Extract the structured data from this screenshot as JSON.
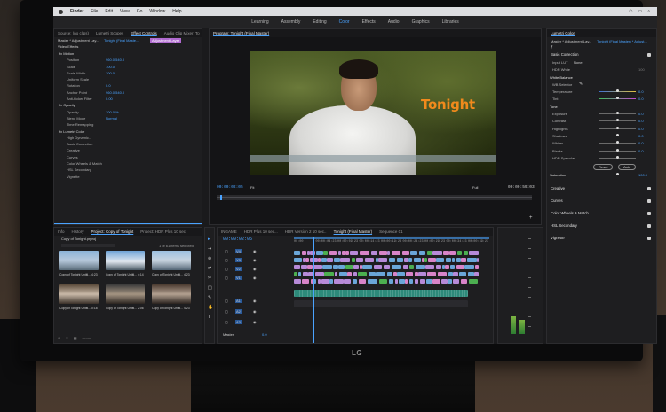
{
  "menubar": {
    "app_name": "Finder",
    "items": [
      "File",
      "Edit",
      "View",
      "Go",
      "Window",
      "Help"
    ]
  },
  "workspaces": {
    "tabs": [
      "Learning",
      "Assembly",
      "Editing",
      "Color",
      "Effects",
      "Audio",
      "Graphics",
      "Libraries"
    ],
    "active": "Color"
  },
  "source_panel": {
    "tabs": [
      "Source: (no clips)",
      "Lumetri Scopes",
      "Effect Controls",
      "Audio Clip Mixer: To"
    ],
    "master_label": "Master * Adjustment Lay...",
    "clip_label": "Tonight (Final Maste...",
    "adjustment_layer_label": "Adjustment Layer",
    "video_effects_label": "Video Effects",
    "rows": [
      {
        "label": "fx  Motion",
        "value": ""
      },
      {
        "label": "Position",
        "value": "960.0   540.0"
      },
      {
        "label": "Scale",
        "value": "100.0"
      },
      {
        "label": "Scale Width",
        "value": "100.0"
      },
      {
        "label": "Uniform Scale",
        "value": ""
      },
      {
        "label": "Rotation",
        "value": "0.0"
      },
      {
        "label": "Anchor Point",
        "value": "960.0   540.0"
      },
      {
        "label": "Anti-flicker Filter",
        "value": "0.00"
      },
      {
        "label": "fx  Opacity",
        "value": ""
      },
      {
        "label": "Opacity",
        "value": "100.0 %"
      },
      {
        "label": "Blend Mode",
        "value": "Normal"
      },
      {
        "label": "Time Remapping",
        "value": ""
      },
      {
        "label": "fx  Lumetri Color",
        "value": ""
      },
      {
        "label": "High Dynamic...",
        "value": ""
      },
      {
        "label": "Basic Correction",
        "value": ""
      },
      {
        "label": "Creative",
        "value": ""
      },
      {
        "label": "Curves",
        "value": ""
      },
      {
        "label": "Color Wheels & Match",
        "value": ""
      },
      {
        "label": "HSL Secondary",
        "value": ""
      },
      {
        "label": "Vignette",
        "value": ""
      }
    ]
  },
  "program_monitor": {
    "tab_label": "Program: Tonight (Final Master)",
    "title_overlay": "Tonight",
    "timecode_left": "00:00:02:05",
    "timecode_right": "00:00:59:03",
    "fit_label": "Fit",
    "full_label": "Full"
  },
  "project_panel": {
    "tabs": [
      "Info",
      "History",
      "Project: Copy of Tonight",
      "Project: HDR Plus 10 sec"
    ],
    "path": "Copy of Tonight.prproj",
    "count_label": "1 of 61 items selected",
    "items": [
      {
        "caption": "Copy of Tonight Untitl...",
        "duration": "4:23"
      },
      {
        "caption": "Copy of Tonight Untitl...",
        "duration": "4:14"
      },
      {
        "caption": "Copy of Tonight Untitl...",
        "duration": "4:23"
      },
      {
        "caption": "Copy of Tonight Untitl...",
        "duration": "0:18"
      },
      {
        "caption": "Copy of Tonight Untitl...",
        "duration": "2:06"
      },
      {
        "caption": "Copy of Tonight Untitl...",
        "duration": "4:23"
      }
    ]
  },
  "timeline": {
    "tabs": [
      "INGAME",
      "HDR Plus 10 sec...",
      "HDR Version 2 10 sec..",
      "Tonight (Final Master)",
      "Sequence 01"
    ],
    "active_tab": "Tonight (Final Master)",
    "timecode": "00:00:02:05",
    "ruler": [
      "00:00",
      "00:00:04:23",
      "00:00:09:23",
      "00:00:14:23",
      "00:00:19:23",
      "00:00:24:23",
      "00:00:29:23",
      "00:00:34:23",
      "00:00:39:23"
    ],
    "track_labels": [
      "V4",
      "V3",
      "V2",
      "V1",
      "A1",
      "A2",
      "A3"
    ],
    "master_label": "Master",
    "master_value": "0.0"
  },
  "lumetri": {
    "tab_label": "Lumetri Color",
    "master_label": "Master * Adjustment Lay...",
    "clip_label": "Tonight (Final Master) * Adjust...",
    "basic_correction": "Basic Correction",
    "input_lut_label": "Input LUT",
    "input_lut_value": "None",
    "hdr_white_label": "HDR White",
    "hdr_white_value": "100",
    "white_balance_label": "White Balance",
    "wb_selector_label": "WB Selector",
    "tone_label": "Tone",
    "sliders": [
      {
        "label": "Temperature",
        "value": "0.0",
        "pos": 0.5
      },
      {
        "label": "Tint",
        "value": "0.0",
        "pos": 0.5
      },
      {
        "label": "Exposure",
        "value": "0.0",
        "pos": 0.5
      },
      {
        "label": "Contrast",
        "value": "0.0",
        "pos": 0.5
      },
      {
        "label": "Highlights",
        "value": "0.0",
        "pos": 0.5
      },
      {
        "label": "Shadows",
        "value": "0.0",
        "pos": 0.5
      },
      {
        "label": "Whites",
        "value": "0.0",
        "pos": 0.5
      },
      {
        "label": "Blacks",
        "value": "0.0",
        "pos": 0.5
      },
      {
        "label": "HDR Specular",
        "value": "",
        "pos": 0.5
      }
    ],
    "reset_label": "Reset",
    "auto_label": "Auto",
    "saturation_label": "Saturation",
    "saturation_value": "100.0",
    "sections": [
      "Creative",
      "Curves",
      "Color Wheels & Match",
      "HSL Secondary",
      "Vignette"
    ]
  },
  "monitor_brand": "LG",
  "colors": {
    "accent": "#4aa3ff",
    "title_orange": "#f08a1c",
    "panel_bg": "#1e1e20",
    "clip_blue": "#6aa6d8",
    "clip_purple": "#b78ad8",
    "clip_green": "#4caf50",
    "clip_pink": "#d884c8",
    "audio_teal": "#2d8a7a"
  }
}
